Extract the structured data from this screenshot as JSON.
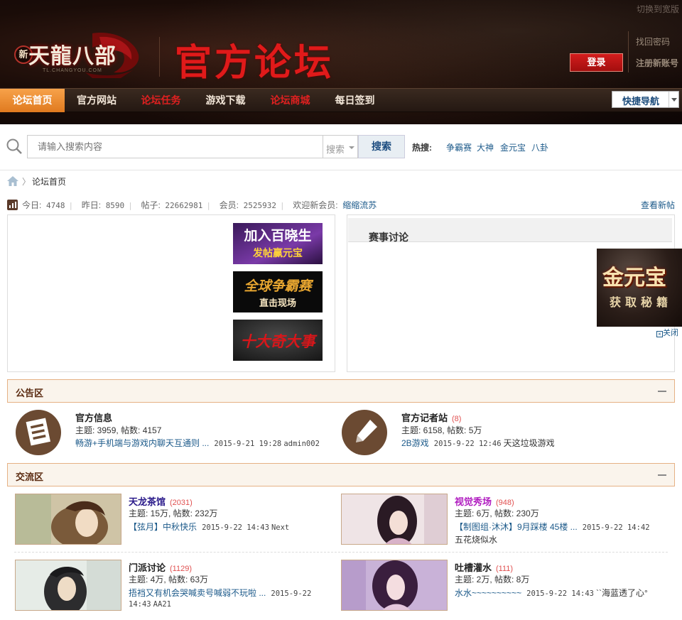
{
  "header": {
    "switch_wide": "切换到宽版",
    "logo_xin": "新",
    "logo_name": "天龍八部",
    "logo_site": "TL.CHANGYOU.COM",
    "forum_title": "官方论坛",
    "login": "登录",
    "find_password": "找回密码",
    "register": "注册新账号"
  },
  "nav": {
    "items": [
      {
        "label": "论坛首页"
      },
      {
        "label": "官方网站"
      },
      {
        "label": "论坛任务"
      },
      {
        "label": "游戏下载"
      },
      {
        "label": "论坛商城"
      },
      {
        "label": "每日签到"
      }
    ],
    "quick_nav": "快捷导航"
  },
  "search": {
    "placeholder": "请输入搜索内容",
    "type": "搜索",
    "button": "搜索",
    "hot_label": "热搜:",
    "hot_words": [
      "争霸赛",
      "大神",
      "金元宝",
      "八卦"
    ]
  },
  "breadcrumb": {
    "sep": "〉",
    "current": "论坛首页"
  },
  "stats": {
    "today_label": "今日:",
    "today": "4748",
    "yesterday_label": "昨日:",
    "yesterday": "8590",
    "posts_label": "帖子:",
    "posts": "22662981",
    "members_label": "会员:",
    "members": "2525932",
    "welcome_label": "欢迎新会员:",
    "new_member": "缩缩流苏",
    "view_new": "查看新帖"
  },
  "banners": [
    {
      "line1": "加入百晓生",
      "line2": "发帖赢元宝"
    },
    {
      "line1": "全球争霸赛",
      "line2": "直击现场"
    },
    {
      "line1": "十大奇大事"
    }
  ],
  "right_panel": {
    "title": "赛事讨论"
  },
  "float_ad": {
    "line1": "金元宝",
    "line2": "获取秘籍",
    "close": "关闭"
  },
  "sections": {
    "notice": {
      "title": "公告区",
      "forums": [
        {
          "name": "官方信息",
          "count": "",
          "meta": "主题: 3959, 帖数: 4157",
          "last_link": "畅游+手机端与游戏内聊天互通则 ...",
          "last_time": "2015-9-21 19:28",
          "last_user": "admin002"
        },
        {
          "name": "官方记者站",
          "count": "(8)",
          "meta": "主题: 6158, 帖数: 5万",
          "last_link": "2B游戏",
          "last_time": "2015-9-22 12:46",
          "last_user": "天这垃圾游戏"
        }
      ]
    },
    "exchange": {
      "title": "交流区",
      "forums": [
        {
          "name": "天龙茶馆",
          "count": "(2031)",
          "color": "#2a1a8a",
          "meta": "主题: 15万, 帖数: 232万",
          "last_link": "【弦月】中秋快乐",
          "last_time": "2015-9-22 14:43",
          "last_user": "Next"
        },
        {
          "name": "视觉秀场",
          "count": "(948)",
          "color": "#b01cc0",
          "meta": "主题: 6万, 帖数: 230万",
          "last_link": "【制图组·沐沐】9月踩楼 45楼 ...",
          "last_time": "2015-9-22 14:42",
          "last_user": "五花烧似水"
        },
        {
          "name": "门派讨论",
          "count": "(1129)",
          "color": "#222",
          "meta": "主题: 4万, 帖数: 63万",
          "last_link": "捂裆又有机会哭喊卖号喊弱不玩啦 ...",
          "last_time": "2015-9-22",
          "last_time2": "14:43",
          "last_user": "AA21"
        },
        {
          "name": "吐槽灌水",
          "count": "(111)",
          "color": "#222",
          "meta": "主题: 2万, 帖数: 8万",
          "last_link": "水水~~~~~~~~~~",
          "last_time": "2015-9-22 14:43",
          "last_user": "``海蓝透了心°"
        }
      ]
    }
  },
  "colors": {
    "nav_active": "#f0902e",
    "accent_red": "#e01a1a",
    "link_blue": "#1c5a8a",
    "section_border": "#e6b184"
  }
}
